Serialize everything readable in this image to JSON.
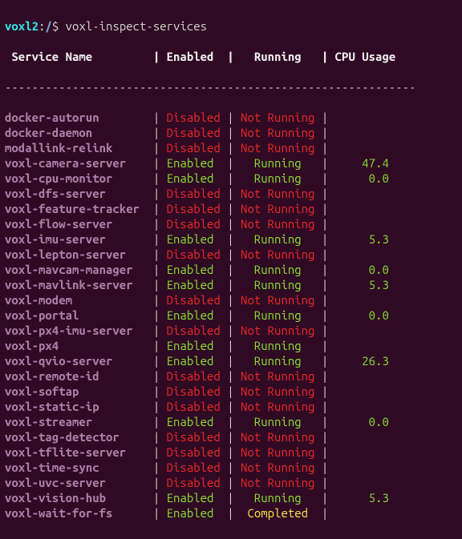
{
  "prompt": {
    "host": "voxl2",
    "path": "/",
    "symbol": "$",
    "command": "voxl-inspect-services"
  },
  "header": {
    "name": "Service Name",
    "enabled": "Enabled",
    "running": "Running",
    "cpu": "CPU Usage"
  },
  "dashes": "-------------------------------------------------------------",
  "rows": [
    {
      "name": "docker-autorun",
      "enabled": "Disabled",
      "running": "Not Running",
      "cpu": ""
    },
    {
      "name": "docker-daemon",
      "enabled": "Disabled",
      "running": "Not Running",
      "cpu": ""
    },
    {
      "name": "modallink-relink",
      "enabled": "Disabled",
      "running": "Not Running",
      "cpu": ""
    },
    {
      "name": "voxl-camera-server",
      "enabled": "Enabled",
      "running": "Running",
      "cpu": "47.4"
    },
    {
      "name": "voxl-cpu-monitor",
      "enabled": "Enabled",
      "running": "Running",
      "cpu": "0.0"
    },
    {
      "name": "voxl-dfs-server",
      "enabled": "Disabled",
      "running": "Not Running",
      "cpu": ""
    },
    {
      "name": "voxl-feature-tracker",
      "enabled": "Disabled",
      "running": "Not Running",
      "cpu": ""
    },
    {
      "name": "voxl-flow-server",
      "enabled": "Disabled",
      "running": "Not Running",
      "cpu": ""
    },
    {
      "name": "voxl-imu-server",
      "enabled": "Enabled",
      "running": "Running",
      "cpu": "5.3"
    },
    {
      "name": "voxl-lepton-server",
      "enabled": "Disabled",
      "running": "Not Running",
      "cpu": ""
    },
    {
      "name": "voxl-mavcam-manager",
      "enabled": "Enabled",
      "running": "Running",
      "cpu": "0.0"
    },
    {
      "name": "voxl-mavlink-server",
      "enabled": "Enabled",
      "running": "Running",
      "cpu": "5.3"
    },
    {
      "name": "voxl-modem",
      "enabled": "Disabled",
      "running": "Not Running",
      "cpu": ""
    },
    {
      "name": "voxl-portal",
      "enabled": "Enabled",
      "running": "Running",
      "cpu": "0.0"
    },
    {
      "name": "voxl-px4-imu-server",
      "enabled": "Disabled",
      "running": "Not Running",
      "cpu": ""
    },
    {
      "name": "voxl-px4",
      "enabled": "Enabled",
      "running": "Running",
      "cpu": ""
    },
    {
      "name": "voxl-qvio-server",
      "enabled": "Enabled",
      "running": "Running",
      "cpu": "26.3"
    },
    {
      "name": "voxl-remote-id",
      "enabled": "Disabled",
      "running": "Not Running",
      "cpu": ""
    },
    {
      "name": "voxl-softap",
      "enabled": "Disabled",
      "running": "Not Running",
      "cpu": ""
    },
    {
      "name": "voxl-static-ip",
      "enabled": "Disabled",
      "running": "Not Running",
      "cpu": ""
    },
    {
      "name": "voxl-streamer",
      "enabled": "Enabled",
      "running": "Running",
      "cpu": "0.0"
    },
    {
      "name": "voxl-tag-detector",
      "enabled": "Disabled",
      "running": "Not Running",
      "cpu": ""
    },
    {
      "name": "voxl-tflite-server",
      "enabled": "Disabled",
      "running": "Not Running",
      "cpu": ""
    },
    {
      "name": "voxl-time-sync",
      "enabled": "Disabled",
      "running": "Not Running",
      "cpu": ""
    },
    {
      "name": "voxl-uvc-server",
      "enabled": "Disabled",
      "running": "Not Running",
      "cpu": ""
    },
    {
      "name": "voxl-vision-hub",
      "enabled": "Enabled",
      "running": "Running",
      "cpu": "5.3"
    },
    {
      "name": "voxl-wait-for-fs",
      "enabled": "Enabled",
      "running": "Completed",
      "cpu": ""
    }
  ],
  "chart_data": {
    "type": "table",
    "title": "voxl-inspect-services",
    "categories": [
      "Service Name",
      "Enabled",
      "Running",
      "CPU Usage"
    ],
    "series": [
      {
        "name": "docker-autorun",
        "values": [
          "Disabled",
          "Not Running",
          null
        ]
      },
      {
        "name": "docker-daemon",
        "values": [
          "Disabled",
          "Not Running",
          null
        ]
      },
      {
        "name": "modallink-relink",
        "values": [
          "Disabled",
          "Not Running",
          null
        ]
      },
      {
        "name": "voxl-camera-server",
        "values": [
          "Enabled",
          "Running",
          47.4
        ]
      },
      {
        "name": "voxl-cpu-monitor",
        "values": [
          "Enabled",
          "Running",
          0.0
        ]
      },
      {
        "name": "voxl-dfs-server",
        "values": [
          "Disabled",
          "Not Running",
          null
        ]
      },
      {
        "name": "voxl-feature-tracker",
        "values": [
          "Disabled",
          "Not Running",
          null
        ]
      },
      {
        "name": "voxl-flow-server",
        "values": [
          "Disabled",
          "Not Running",
          null
        ]
      },
      {
        "name": "voxl-imu-server",
        "values": [
          "Enabled",
          "Running",
          5.3
        ]
      },
      {
        "name": "voxl-lepton-server",
        "values": [
          "Disabled",
          "Not Running",
          null
        ]
      },
      {
        "name": "voxl-mavcam-manager",
        "values": [
          "Enabled",
          "Running",
          0.0
        ]
      },
      {
        "name": "voxl-mavlink-server",
        "values": [
          "Enabled",
          "Running",
          5.3
        ]
      },
      {
        "name": "voxl-modem",
        "values": [
          "Disabled",
          "Not Running",
          null
        ]
      },
      {
        "name": "voxl-portal",
        "values": [
          "Enabled",
          "Running",
          0.0
        ]
      },
      {
        "name": "voxl-px4-imu-server",
        "values": [
          "Disabled",
          "Not Running",
          null
        ]
      },
      {
        "name": "voxl-px4",
        "values": [
          "Enabled",
          "Running",
          null
        ]
      },
      {
        "name": "voxl-qvio-server",
        "values": [
          "Enabled",
          "Running",
          26.3
        ]
      },
      {
        "name": "voxl-remote-id",
        "values": [
          "Disabled",
          "Not Running",
          null
        ]
      },
      {
        "name": "voxl-softap",
        "values": [
          "Disabled",
          "Not Running",
          null
        ]
      },
      {
        "name": "voxl-static-ip",
        "values": [
          "Disabled",
          "Not Running",
          null
        ]
      },
      {
        "name": "voxl-streamer",
        "values": [
          "Enabled",
          "Running",
          0.0
        ]
      },
      {
        "name": "voxl-tag-detector",
        "values": [
          "Disabled",
          "Not Running",
          null
        ]
      },
      {
        "name": "voxl-tflite-server",
        "values": [
          "Disabled",
          "Not Running",
          null
        ]
      },
      {
        "name": "voxl-time-sync",
        "values": [
          "Disabled",
          "Not Running",
          null
        ]
      },
      {
        "name": "voxl-uvc-server",
        "values": [
          "Disabled",
          "Not Running",
          null
        ]
      },
      {
        "name": "voxl-vision-hub",
        "values": [
          "Enabled",
          "Running",
          5.3
        ]
      },
      {
        "name": "voxl-wait-for-fs",
        "values": [
          "Enabled",
          "Completed",
          null
        ]
      }
    ]
  }
}
